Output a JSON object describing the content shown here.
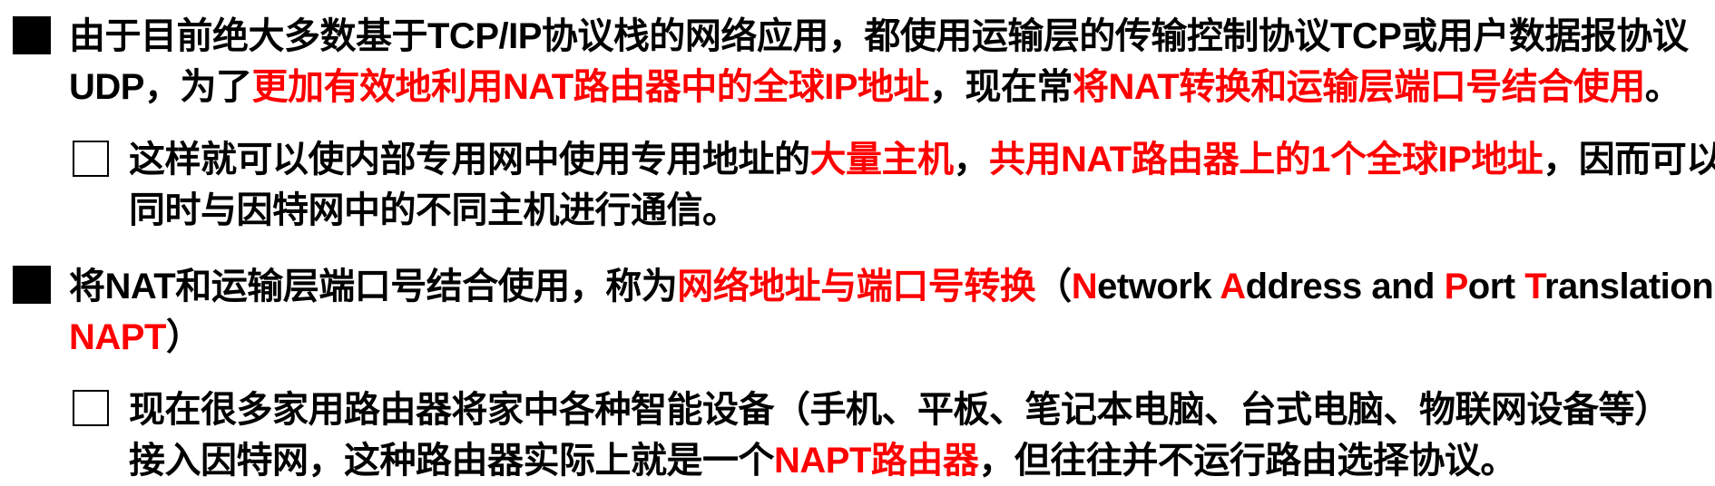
{
  "bullets": [
    {
      "lines": [
        [
          {
            "text": "由于目前绝大多数基于TCP/IP协议栈的网络应用，都使用运输层的传输控制协议TCP或用户数据报协议",
            "red": false
          }
        ],
        [
          {
            "text": "UDP，为了",
            "red": false
          },
          {
            "text": "更加有效地利用NAT路由器中的全球IP地址",
            "red": true
          },
          {
            "text": "，现在常",
            "red": false
          },
          {
            "text": "将NAT转换和运输层端口号结合使用",
            "red": true
          },
          {
            "text": "。",
            "red": false
          }
        ]
      ]
    },
    {
      "lines": [
        [
          {
            "text": "这样就可以使内部专用网中使用专用地址的",
            "red": false
          },
          {
            "text": "大量主机",
            "red": true
          },
          {
            "text": "，",
            "red": false
          },
          {
            "text": "共用NAT路由器上的1个全球IP地址",
            "red": true
          },
          {
            "text": "，因而可以",
            "red": false
          }
        ],
        [
          {
            "text": "同时与因特网中的不同主机进行通信。",
            "red": false
          }
        ]
      ]
    },
    {
      "lines": [
        [
          {
            "text": "将NAT和运输层端口号结合使用，称为",
            "red": false
          },
          {
            "text": "网络地址与端口号转换",
            "red": true
          },
          {
            "text": "（",
            "red": false
          },
          {
            "text": "N",
            "red": true
          },
          {
            "text": "etwork ",
            "red": false
          },
          {
            "text": "A",
            "red": true
          },
          {
            "text": "ddress and ",
            "red": false
          },
          {
            "text": "P",
            "red": true
          },
          {
            "text": "ort ",
            "red": false
          },
          {
            "text": "T",
            "red": true
          },
          {
            "text": "ranslation，",
            "red": false
          }
        ],
        [
          {
            "text": "NAPT",
            "red": true
          },
          {
            "text": "）",
            "red": false
          }
        ]
      ]
    },
    {
      "lines": [
        [
          {
            "text": "现在很多家用路由器将家中各种智能设备（手机、平板、笔记本电脑、台式电脑、物联网设备等）",
            "red": false
          }
        ],
        [
          {
            "text": "接入因特网，这种路由器实际上就是一个",
            "red": false
          },
          {
            "text": "NAPT路由器",
            "red": true
          },
          {
            "text": "，但往往并不运行路由选择协议。",
            "red": false
          }
        ]
      ]
    }
  ],
  "colors": {
    "text": "#000000",
    "highlight": "#ff0000"
  }
}
